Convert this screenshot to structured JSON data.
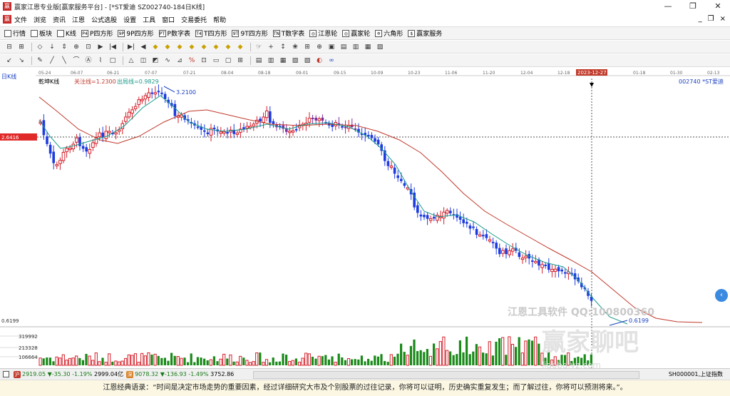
{
  "window": {
    "title": "赢家江恩专业版[赢家服务平台] - [*ST爱迪  SZ002740-184日K线]",
    "controls": [
      "—",
      "❐",
      "✕"
    ]
  },
  "menubar": {
    "items": [
      "文件",
      "浏览",
      "资讯",
      "江恩",
      "公式选股",
      "设置",
      "工具",
      "窗口",
      "交易委托",
      "帮助"
    ],
    "right_controls": [
      "_",
      "❐",
      "×"
    ]
  },
  "toolbar1": {
    "items": [
      {
        "label": "行情",
        "icon": "grid-icon"
      },
      {
        "label": "板块",
        "icon": "blocks-icon"
      },
      {
        "label": "K线",
        "icon": "kline-icon"
      },
      {
        "label": "P四方形",
        "icon": "p-square-icon",
        "glyph": "P4"
      },
      {
        "label": "9P四方形",
        "icon": "9p-square-icon",
        "glyph": "9P"
      },
      {
        "label": "P数字表",
        "icon": "p-table-icon",
        "glyph": "PT"
      },
      {
        "label": "T四方形",
        "icon": "t-square-icon",
        "glyph": "T4"
      },
      {
        "label": "9T四方形",
        "icon": "9t-square-icon",
        "glyph": "9T"
      },
      {
        "label": "T数字表",
        "icon": "t-table-icon",
        "glyph": "TN"
      },
      {
        "label": "江恩轮",
        "icon": "gann-wheel-icon",
        "glyph": "◎"
      },
      {
        "label": "赢家轮",
        "icon": "winner-wheel-icon",
        "glyph": "◎"
      },
      {
        "label": "六角形",
        "icon": "hexagon-icon",
        "glyph": "✡"
      },
      {
        "label": "赢家服务",
        "icon": "service-icon",
        "glyph": "$"
      }
    ]
  },
  "toolbar2": {
    "symbols": [
      "⊟",
      "⊞",
      "◇",
      "↓",
      "⇕",
      "⊕",
      "⊡",
      "▶",
      "|◀",
      "▶|",
      "◀",
      "◆",
      "◆",
      "◆",
      "◆",
      "◆",
      "◆",
      "◆",
      "◆",
      "☞",
      "+",
      "↕",
      "❀",
      "⊞",
      "⊕",
      "▣",
      "▤",
      "▥",
      "▦",
      "▧"
    ]
  },
  "toolbar3": {
    "symbols": [
      "↙",
      "↘",
      "✎",
      "╱",
      "╲",
      "⌒",
      "Ⓐ",
      "⌇",
      "□",
      "△",
      "◫",
      "◩",
      "∿",
      "⊿",
      "%",
      "⊡",
      "▭",
      "▢",
      "⊞",
      "▤",
      "▥",
      "▦",
      "▧",
      "▨",
      "◐",
      "∞"
    ]
  },
  "chart": {
    "period_label": "日K线",
    "indicator_name": "乾坤K线",
    "guanzhu_label": "关注线=1.2300",
    "chuju_label": "出局线=0.9829",
    "symbol_label": "002740  *ST爱迪",
    "y_axis_left_label": "2.6416",
    "max_price_label": "3.2100",
    "min_price_label": "0.6199",
    "bottom_price_label": "0.6199",
    "cursor_date": "2023-12-27",
    "volume_labels": [
      "319992",
      "213328",
      "106664"
    ],
    "colors": {
      "up": "#d3202a",
      "down": "#1d3be0",
      "purple": "#7b2f9c",
      "ma_short": "#1a9a8a",
      "ma_long": "#c0392b",
      "vol_up": "#d3202a",
      "vol_down": "#1a8a1a",
      "cursor_date_bg": "#c0392b"
    }
  },
  "chart_data": {
    "type": "candlestick",
    "x_dates": [
      "05-24",
      "06-07",
      "06-21",
      "07-07",
      "07-21",
      "08-04",
      "08-18",
      "09-01",
      "09-15",
      "10-09",
      "10-23",
      "11-06",
      "11-20",
      "12-04",
      "12-18",
      "2023-12-27",
      "01-18",
      "01-30",
      "02-13"
    ],
    "ylim": [
      0.6199,
      3.21
    ],
    "markers": {
      "high": 3.21,
      "low": 0.6199,
      "hline": 2.6416
    },
    "volume_axis": [
      106664,
      213328,
      319992
    ]
  },
  "statusbar": {
    "sh_badge": "沪",
    "sh_index": "2919.05",
    "sh_change": "▼-35.30",
    "sh_pct": "-1.19%",
    "sh_amount": "2999.04亿",
    "sz_badge": "深",
    "sz_index": "9078.32",
    "sz_change": "▼-136.93",
    "sz_pct": "-1.49%",
    "sz_amount": "3752.86",
    "right_code": "SH000001,上证指数"
  },
  "quote": {
    "text": "江恩经典语录：“时间是决定市场走势的重要因素，经过详细研究大市及个别股票的过往记录，你将可以证明，历史确实重复发生；而了解过往，你将可以预测将来。”。"
  },
  "watermark": {
    "line1": "江恩工具软件 QQ:100800360",
    "line2": "赢家聊吧",
    "line3": "liaoba.yz.com"
  },
  "side_button": "‹"
}
